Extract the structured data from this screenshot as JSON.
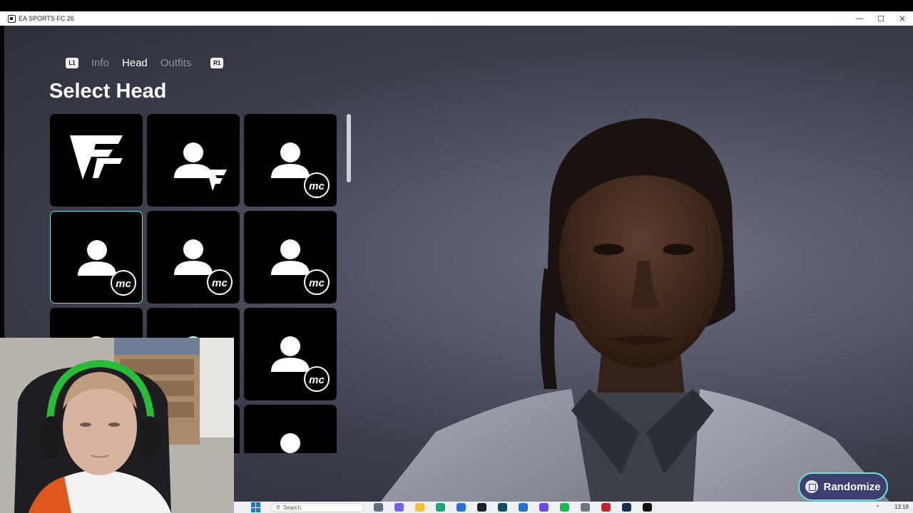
{
  "window": {
    "title": "EA SPORTS FC 26",
    "minimize": "—",
    "maximize": "☐",
    "close": "✕"
  },
  "tabs": {
    "left_shoulder": "L1",
    "right_shoulder": "R1",
    "items": [
      {
        "label": "Info",
        "active": false
      },
      {
        "label": "Head",
        "active": true
      },
      {
        "label": "Outfits",
        "active": false
      }
    ]
  },
  "page_title": "Select Head",
  "tiles": [
    {
      "kind": "fc-logo",
      "selected": false
    },
    {
      "kind": "person-fc",
      "selected": false
    },
    {
      "kind": "person-mc",
      "selected": false
    },
    {
      "kind": "person-mc",
      "selected": true
    },
    {
      "kind": "person-mc",
      "selected": false
    },
    {
      "kind": "person-mc",
      "selected": false
    },
    {
      "kind": "person-mc",
      "selected": false
    },
    {
      "kind": "person-mc",
      "selected": false
    },
    {
      "kind": "person-mc",
      "selected": false
    },
    {
      "kind": "person-mc",
      "selected": false
    },
    {
      "kind": "person-mc",
      "selected": false
    },
    {
      "kind": "person-mc",
      "selected": false
    }
  ],
  "randomize_button": {
    "label": "Randomize",
    "accent": "#6fe0e0",
    "fill": "#3d3f6e"
  },
  "taskbar": {
    "search_placeholder": "Search",
    "time": "13:18"
  },
  "colors": {
    "selected_border": "#6fe0e0",
    "tile_bg": "#000000",
    "background": "#4a4d5b"
  }
}
